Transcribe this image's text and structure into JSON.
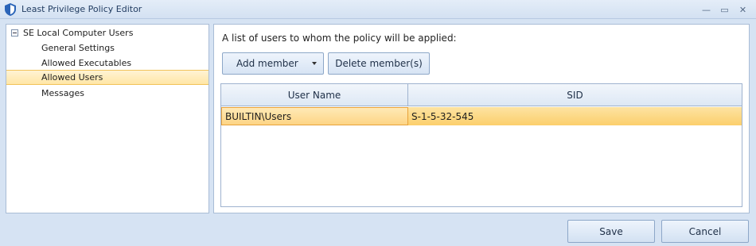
{
  "window": {
    "title": "Least Privilege Policy Editor",
    "minimize_glyph": "—",
    "restore_glyph": "▭",
    "close_glyph": "✕"
  },
  "tree": {
    "root_label": "SE Local Computer Users",
    "items": [
      {
        "label": "General Settings"
      },
      {
        "label": "Allowed Executables"
      },
      {
        "label": "Allowed Users"
      },
      {
        "label": "Messages"
      }
    ],
    "selected_index": 2
  },
  "main": {
    "instruction": "A list of users to whom the policy will be applied:",
    "add_member_label": "Add member",
    "delete_member_label": "Delete member(s)",
    "grid": {
      "columns": [
        "User Name",
        "SID"
      ],
      "rows": [
        {
          "user_name": "BUILTIN\\Users",
          "sid": "S-1-5-32-545"
        }
      ]
    }
  },
  "footer": {
    "save_label": "Save",
    "cancel_label": "Cancel"
  },
  "colors": {
    "selection": "#fcd27a",
    "accent": "#2a64b8"
  }
}
